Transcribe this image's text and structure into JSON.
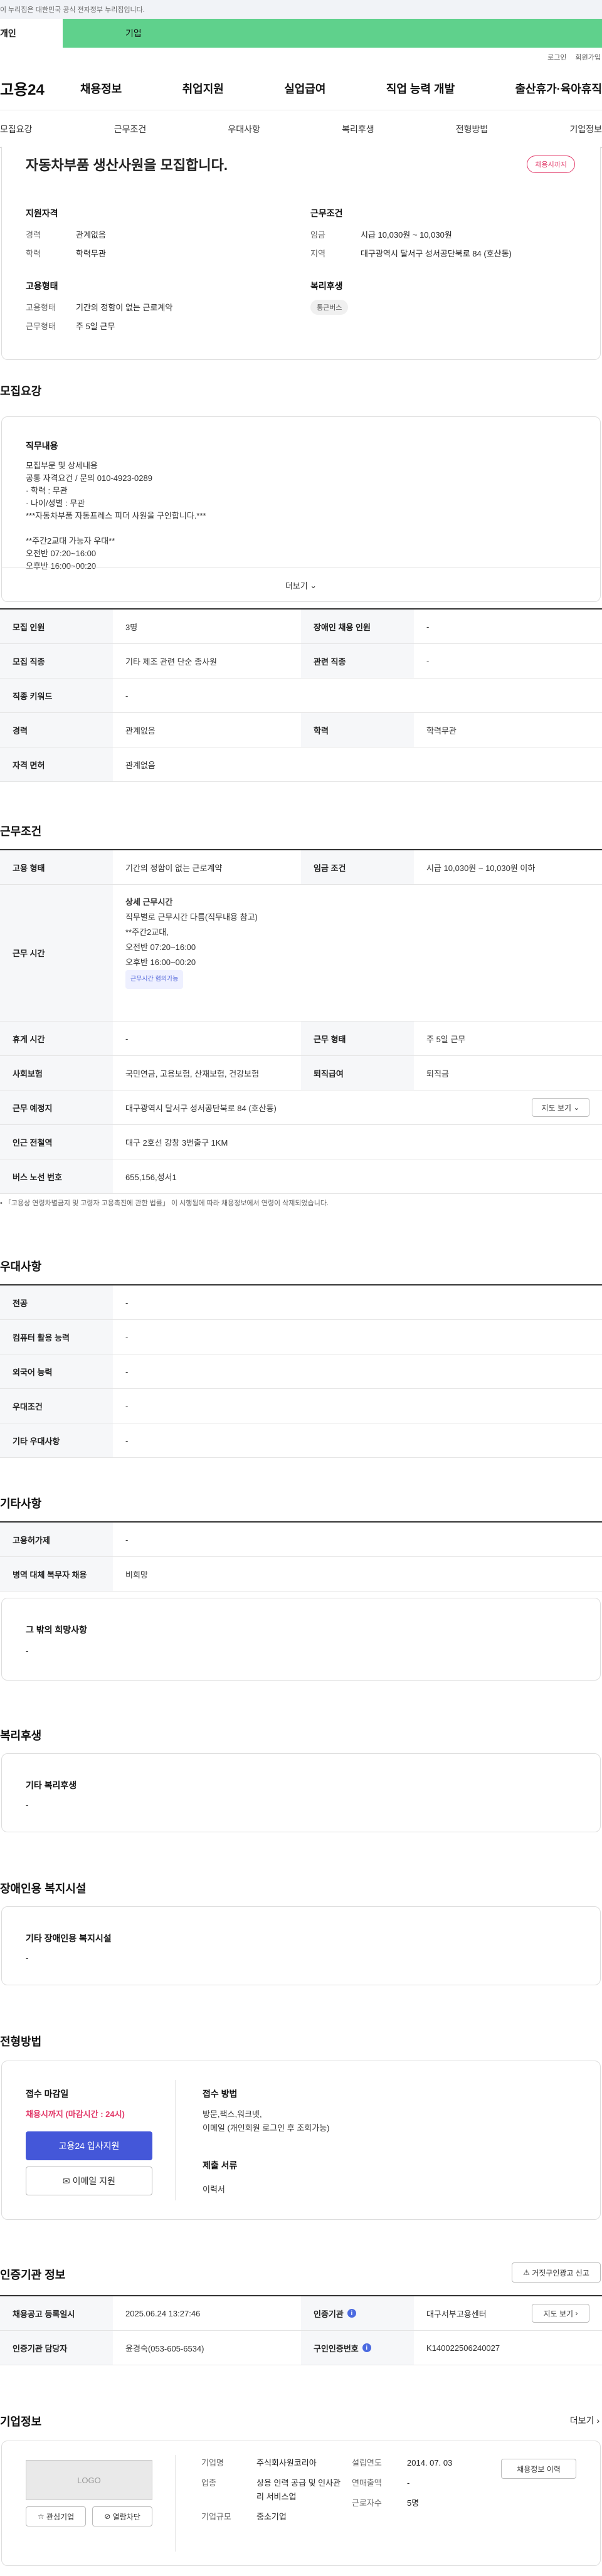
{
  "gov_banner": "이 누리집은 대한민국 공식 전자정부 누리집입니다.",
  "user_tabs": [
    "개인",
    "기업"
  ],
  "util_links": [
    "로그인",
    "회원가입"
  ],
  "logo": "고용24",
  "gnb": [
    "채용정보",
    "취업지원",
    "실업급여",
    "직업 능력 개발",
    "출산휴가·육아휴직"
  ],
  "lnb": [
    "모집요강",
    "근무조건",
    "우대사항",
    "복리후생",
    "전형방법",
    "기업정보"
  ],
  "summary": {
    "title": "자동차부품 생산사원을 모집합니다.",
    "badge": "채용시까지",
    "qual_title": "지원자격",
    "qual": [
      {
        "k": "경력",
        "v": "관계없음"
      },
      {
        "k": "학력",
        "v": "학력무관"
      }
    ],
    "cond_title": "근무조건",
    "cond": [
      {
        "k": "임금",
        "v": "시급 10,030원 ~ 10,030원"
      },
      {
        "k": "지역",
        "v": "대구광역시 달서구 성서공단북로 84 (호산동)"
      }
    ],
    "emp_title": "고용형태",
    "emp": [
      {
        "k": "고용형태",
        "v": "기간의 정함이 없는 근로계약"
      },
      {
        "k": "근무형태",
        "v": "주 5일 근무"
      }
    ],
    "welfare_title": "복리후생",
    "welfare_tag": "통근버스"
  },
  "recruit": {
    "title": "모집요강",
    "job_title": "직무내용",
    "lines": [
      "모집부문 및 상세내용",
      "공통 자격요건     / 문의 010-4923-0289",
      "· 학력 : 무관",
      "· 나이/성별 : 무관",
      "***자동차부품 자동프레스 피더 사원을 구인합니다.***",
      "",
      "**주간2교대 가능자 우대**",
      "오전반 07:20~16:00",
      "오후반 16:00~00:20"
    ],
    "more": "더보기",
    "rows": [
      [
        {
          "k": "모집 인원",
          "v": "3명"
        },
        {
          "k": "장애인 채용 인원",
          "v": "-"
        }
      ],
      [
        {
          "k": "모집 직종",
          "v": "기타 제조 관련 단순 종사원"
        },
        {
          "k": "관련 직종",
          "v": "-"
        }
      ],
      [
        {
          "k": "직종 키워드",
          "v": "-"
        }
      ],
      [
        {
          "k": "경력",
          "v": "관계없음"
        },
        {
          "k": "학력",
          "v": "학력무관"
        }
      ],
      [
        {
          "k": "자격 면허",
          "v": "관계없음"
        }
      ]
    ]
  },
  "work": {
    "title": "근무조건",
    "emp_k": "고용 형태",
    "emp_v": "기간의 정함이 없는 근로계약",
    "wage_k": "임금 조건",
    "wage_v": "시급 10,030원 ~ 10,030원 이하",
    "time_k": "근무 시간",
    "time_title": "상세 근무시간",
    "time_lines": [
      "직무별로 근무시간 다름(직무내용 참고)",
      "**주간2교대,",
      "오전반 07:20~16:00",
      "오후반 16:00~00:20"
    ],
    "time_tag": "근무시간 협의가능",
    "rest_k": "휴게 시간",
    "rest_v": "-",
    "form_k": "근무 형태",
    "form_v": "주 5일 근무",
    "ins_k": "사회보험",
    "ins_v": "국민연금, 고용보험, 산재보험, 건강보험",
    "ret_k": "퇴직급여",
    "ret_v": "퇴직금",
    "place_k": "근무 예정지",
    "place_v": "대구광역시 달서구 성서공단북로 84 (호산동)",
    "map_btn": "지도 보기",
    "station_k": "인근 전철역",
    "station_v": "대구 2호선 강창 3번출구 1KM",
    "bus_k": "버스 노선 번호",
    "bus_v": "655,156,성서1",
    "note": "「고용상 연령차별금지 및 고령자 고용촉진에 관한 법률」 이 시행됨에 따라 채용정보에서 연령이 삭제되었습니다."
  },
  "pref": {
    "title": "우대사항",
    "rows": [
      {
        "k": "전공",
        "v": "-"
      },
      {
        "k": "컴퓨터 활용 능력",
        "v": "-"
      },
      {
        "k": "외국어 능력",
        "v": "-"
      },
      {
        "k": "우대조건",
        "v": "-"
      },
      {
        "k": "기타 우대사항",
        "v": "-"
      }
    ]
  },
  "etc": {
    "title": "기타사항",
    "rows": [
      {
        "k": "고용허가제",
        "v": "-"
      },
      {
        "k": "병역 대체 복무자 채용",
        "v": "비희망"
      }
    ],
    "box_title": "그 밖의 희망사항",
    "box_v": "-"
  },
  "welfare": {
    "title": "복리후생",
    "box_title": "기타 복리후생",
    "box_v": "-"
  },
  "disab": {
    "title": "장애인용 복지시설",
    "box_title": "기타 장애인용 복지시설",
    "box_v": "-"
  },
  "process": {
    "title": "전형방법",
    "deadline_title": "접수 마감일",
    "deadline": "채용시까지 (마감시간 : 24시)",
    "apply_btn": "고용24 입사지원",
    "email_btn": "이메일 지원",
    "method_title": "접수 방법",
    "method": "방문,팩스,워크넷,",
    "method2": "이메일 (개인회원 로그인 후 조회가능)",
    "docs_title": "제출 서류",
    "docs": "이력서"
  },
  "cert": {
    "title": "인증기관 정보",
    "report_btn": "거짓구인광고 신고",
    "r1": [
      {
        "k": "채용공고 등록일시",
        "v": "2025.06.24 13:27:46"
      },
      {
        "k": "인증기관",
        "v": "대구서부고용센터"
      }
    ],
    "map_btn": "지도 보기",
    "r2": [
      {
        "k": "인증기관 담당자",
        "v": "윤경숙(053-605-6534)"
      },
      {
        "k": "구인인증번호",
        "v": "K140022506240027"
      }
    ]
  },
  "company": {
    "title": "기업정보",
    "more": "더보기",
    "logo": "LOGO",
    "fav_btn": "관심기업",
    "block_btn": "열람차단",
    "fields": [
      {
        "k": "기업명",
        "v": "주식회사원코리아"
      },
      {
        "k": "업종",
        "v": "상용 인력 공급 및 인사관리 서비스업"
      },
      {
        "k": "기업규모",
        "v": "중소기업"
      }
    ],
    "fields2": [
      {
        "k": "설립연도",
        "v": "2014. 07. 03"
      },
      {
        "k": "연매출액",
        "v": "-"
      },
      {
        "k": "근로자수",
        "v": "5명"
      }
    ],
    "history_btn": "채용정보 이력"
  }
}
